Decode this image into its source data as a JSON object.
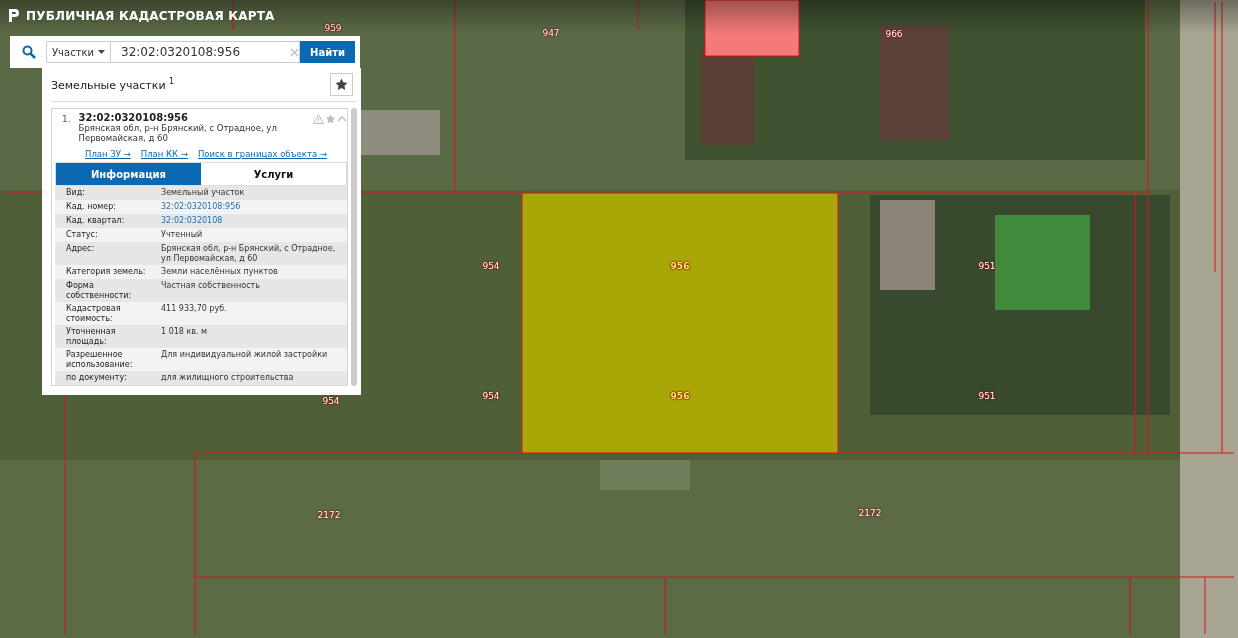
{
  "header": {
    "title": "ПУБЛИЧНАЯ КАДАСТРОВАЯ КАРТА"
  },
  "search": {
    "category": "Участки",
    "value": "32:02:0320108:956",
    "button": "Найти"
  },
  "results": {
    "title": "Земельные участки $^{1}$",
    "items": [
      {
        "index": "1.",
        "number": "32:02:0320108:956",
        "address": "Брянская обл, р-н Брянский, с Отрадное, ул Первомайская, д 60",
        "expanded": true,
        "links": [
          "План ЗУ →",
          "План КК →",
          "Поиск в границах объекта →"
        ],
        "tabs": [
          {
            "label": "Информация",
            "selected": true
          },
          {
            "label": "Услуги",
            "selected": false
          }
        ],
        "fields": [
          {
            "label": "Вид:",
            "value": "Земельный участок",
            "kind": "text"
          },
          {
            "label": "Кад. номер:",
            "value": "32:02:0320108:956",
            "kind": "link"
          },
          {
            "label": "Кад. квартал:",
            "value": "32:02:0320108",
            "kind": "link"
          },
          {
            "label": "Статус:",
            "value": "Учтенный",
            "kind": "text"
          },
          {
            "label": "Адрес:",
            "value": "Брянская обл, р-н Брянский, с Отрадное, ул Первомайская, д 60",
            "kind": "text"
          },
          {
            "label": "Категория земель:",
            "value": "Земли населённых пунктов",
            "kind": "text"
          },
          {
            "label": "Форма собственности:",
            "value": "Частная собственность",
            "kind": "text"
          },
          {
            "label": "Кадастровая стоимость:",
            "value": "411 933,70 руб.",
            "kind": "text"
          },
          {
            "label": "Уточненная площадь:",
            "value": "1 018 кв. м",
            "kind": "text"
          },
          {
            "label": "Разрешенное использование:",
            "value": "Для индивидуальной жилой застройки",
            "kind": "text"
          },
          {
            "label": "по документу:",
            "value": "для жилищного строительства",
            "kind": "text"
          }
        ]
      }
    ]
  },
  "map": {
    "labels": [
      {
        "text": "959",
        "selected": false
      },
      {
        "text": "947",
        "selected": false
      },
      {
        "text": "966",
        "selected": false
      },
      {
        "text": "954",
        "selected": false
      },
      {
        "text": "956",
        "selected": true
      },
      {
        "text": "951",
        "selected": false
      },
      {
        "text": "954",
        "selected": false
      },
      {
        "text": "956",
        "selected": true
      },
      {
        "text": "951",
        "selected": false
      },
      {
        "text": "954",
        "selected": false
      },
      {
        "text": "2172",
        "selected": false
      },
      {
        "text": "2172",
        "selected": false
      }
    ]
  }
}
